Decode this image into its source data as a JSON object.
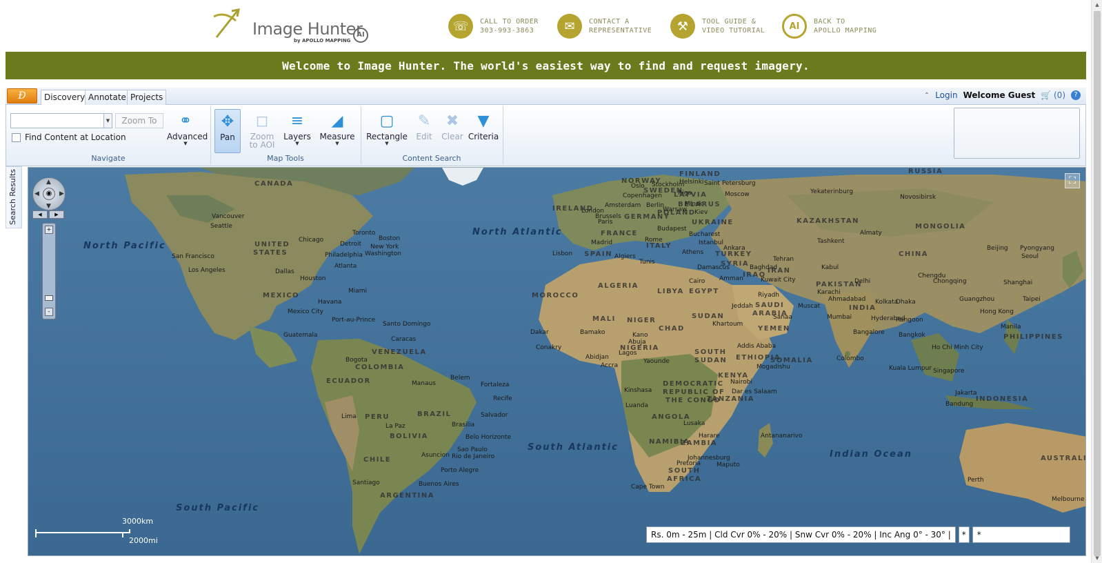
{
  "header": {
    "logo_text": "Image Hunter",
    "logo_sub": "by APOLLO MAPPING",
    "logo_badge": "AI",
    "links": [
      {
        "line1": "CALL TO ORDER",
        "line2": "303-993-3863",
        "icon": "phone-icon"
      },
      {
        "line1": "CONTACT A",
        "line2": "REPRESENTATIVE",
        "icon": "envelope-icon"
      },
      {
        "line1": "TOOL GUIDE &",
        "line2": "VIDEO TUTORIAL",
        "icon": "tools-icon"
      },
      {
        "line1": "BACK TO",
        "line2": "APOLLO MAPPING",
        "icon": "apollo-logo-icon"
      }
    ],
    "accent_color": "#b5a530"
  },
  "banner": {
    "text": "Welcome to Image Hunter. The world's easiest way to find and request imagery.",
    "color": "#6b7a1c"
  },
  "tabbar": {
    "app_button": "Ð",
    "tabs": [
      {
        "label": "Discovery",
        "active": true
      },
      {
        "label": "Annotate",
        "active": false
      },
      {
        "label": "Projects",
        "active": false
      }
    ],
    "login": "Login",
    "welcome": "Welcome Guest",
    "cart": "(0)"
  },
  "ribbon": {
    "navigate": {
      "group_label": "Navigate",
      "combo_value": "",
      "zoom_to": "Zoom To",
      "find_content": "Find Content at Location",
      "find_content_checked": false,
      "advanced": "Advanced"
    },
    "map_tools": {
      "group_label": "Map Tools",
      "pan": "Pan",
      "zoom_aoi_1": "Zoom",
      "zoom_aoi_2": "to AOI",
      "layers": "Layers",
      "measure": "Measure"
    },
    "content_search": {
      "group_label": "Content Search",
      "rectangle": "Rectangle",
      "edit": "Edit",
      "clear": "Clear",
      "criteria": "Criteria"
    }
  },
  "side": {
    "search_results": "Search Results"
  },
  "map": {
    "oceans": {
      "north_pacific": "North Pacific",
      "north_atlantic": "North Atlantic",
      "south_atlantic": "South Atlantic",
      "south_pacific": "South Pacific",
      "indian_ocean": "Indian Ocean"
    },
    "countries": {
      "canada": "CANADA",
      "russia": "RUSSIA",
      "united": "UNITED",
      "states": "STATES",
      "mexico": "MEXICO",
      "kazakhstan": "KAZAKHSTAN",
      "mongolia": "MONGOLIA",
      "china": "CHINA",
      "algeria": "ALGERIA",
      "libya": "LIBYA",
      "egypt": "EGYPT",
      "mali": "MALI",
      "niger": "NIGER",
      "chad": "CHAD",
      "sudan": "SUDAN",
      "saudi": "SAUDI",
      "arabia": "ARABIA",
      "iran": "IRAN",
      "pakistan": "PAKISTAN",
      "india": "INDIA",
      "brazil": "BRAZIL",
      "peru": "PERU",
      "bolivia": "BOLIVIA",
      "argentina": "ARGENTINA",
      "chile": "CHILE",
      "colombia": "COLOMBIA",
      "venezuela": "VENEZUELA",
      "ecuador": "ECUADOR",
      "angola": "ANGOLA",
      "zambia": "ZAMBIA",
      "namibia": "NAMIBIA",
      "south_africa_1": "SOUTH",
      "south_africa_2": "AFRICA",
      "ethiopia": "ETHIOPIA",
      "somalia": "SOMALIA",
      "kenya": "KENYA",
      "tanzania": "TANZANIA",
      "drc_1": "DEMOCRATIC",
      "drc_2": "REPUBLIC OF",
      "drc_3": "THE CONGO",
      "nigeria": "NIGERIA",
      "indonesia": "INDONESIA",
      "philippines": "PHILIPPINES",
      "australia": "AUSTRALIA",
      "morocco": "MOROCCO",
      "spain": "SPAIN",
      "france": "FRANCE",
      "germany": "GERMANY",
      "poland": "POLAND",
      "ukraine": "UKRAINE",
      "turkey": "TURKEY",
      "iraq": "IRAQ",
      "yemen": "YEMEN",
      "south_sudan_1": "SOUTH",
      "south_sudan_2": "SUDAN",
      "finland": "FINLAND",
      "norway": "NORWAY",
      "sweden": "SWEDEN",
      "italy": "ITALY",
      "latvia": "LATVIA",
      "belarus": "BELARUS",
      "ireland": "IRELAND",
      "syria": "SYRIA"
    },
    "cities": {
      "seattle": "Seattle",
      "vancouver": "Vancouver",
      "san_francisco": "San Francisco",
      "los_angeles": "Los Angeles",
      "chicago": "Chicago",
      "detroit": "Detroit",
      "toronto": "Toronto",
      "boston": "Boston",
      "new_york": "New York",
      "washington": "Washington",
      "philadelphia": "Philadelphia",
      "atlanta": "Atlanta",
      "dallas": "Dallas",
      "houston": "Houston",
      "miami": "Miami",
      "havana": "Havana",
      "mexico_city": "Mexico City",
      "guatemala": "Guatemala",
      "port_au_prince": "Port-au-Prince",
      "santo_domingo": "Santo Domingo",
      "caracas": "Caracas",
      "bogota": "Bogota",
      "lima": "Lima",
      "la_paz": "La Paz",
      "manaus": "Manaus",
      "belem": "Belem",
      "fortaleza": "Fortaleza",
      "recife": "Recife",
      "salvador": "Salvador",
      "brasilia": "Brasilia",
      "belo_horizonte": "Belo Horizonte",
      "sao_paulo": "Sao Paulo",
      "rio": "Rio de Janeiro",
      "asuncion": "Asuncion",
      "porto_alegre": "Porto Alegre",
      "buenos_aires": "Buenos Aires",
      "santiago": "Santiago",
      "lisbon": "Lisbon",
      "madrid": "Madrid",
      "london": "London",
      "paris": "Paris",
      "brussels": "Brussels",
      "amsterdam": "Amsterdam",
      "berlin": "Berlin",
      "rome": "Rome",
      "algiers": "Algiers",
      "tunis": "Tunis",
      "cairo": "Cairo",
      "athens": "Athens",
      "istanbul": "Istanbul",
      "ankara": "Ankara",
      "bucharest": "Bucharest",
      "budapest": "Budapest",
      "kiev": "Kiev",
      "moscow": "Moscow",
      "st_petersburg": "Saint Petersburg",
      "stockholm": "Stockholm",
      "helsinki": "Helsinki",
      "oslo": "Oslo",
      "copenhagen": "Copenhagen",
      "warsaw": "Warsaw",
      "minsk": "Minsk",
      "riga": "Riga",
      "baghdad": "Baghdad",
      "tehran": "Tehran",
      "riyadh": "Riyadh",
      "jeddah": "Jeddah",
      "kuwait": "Kuwait City",
      "damascus": "Damascus",
      "amman": "Amman",
      "karachi": "Karachi",
      "delhi": "Delhi",
      "mumbai": "Mumbai",
      "bangalore": "Bangalore",
      "hyderabad": "Hyderabad",
      "kolkata": "Kolkata",
      "ahmadabad": "Ahmadabad",
      "colombo": "Colombo",
      "dhaka": "Dhaka",
      "kabul": "Kabul",
      "tashkent": "Tashkent",
      "almaty": "Almaty",
      "beijing": "Beijing",
      "shanghai": "Shanghai",
      "seoul": "Seoul",
      "pyongyang": "Pyongyang",
      "chongqing": "Chongqing",
      "chengdu": "Chengdu",
      "guangzhou": "Guangzhou",
      "hong_kong": "Hong Kong",
      "taipei": "Taipei",
      "manila": "Manila",
      "bangkok": "Bangkok",
      "rangoon": "Rangoon",
      "ho_chi_minh": "Ho Chi Minh City",
      "kuala_lumpur": "Kuala Lumpur",
      "singapore": "Singapore",
      "jakarta": "Jakarta",
      "bandung": "Bandung",
      "perth": "Perth",
      "melbourne": "Melbourne",
      "novosibirsk": "Novosibirsk",
      "yekaterinburg": "Yekaterinburg",
      "dakar": "Dakar",
      "conakry": "Conakry",
      "abidjan": "Abidjan",
      "accra": "Accra",
      "lagos": "Lagos",
      "abuja": "Abuja",
      "kano": "Kano",
      "bamako": "Bamako",
      "khartoum": "Khartoum",
      "addis_ababa": "Addis Ababa",
      "mogadishu": "Mogadishu",
      "nairobi": "Nairobi",
      "dar_es_salaam": "Dar es Salaam",
      "kinshasa": "Kinshasa",
      "luanda": "Luanda",
      "lusaka": "Lusaka",
      "harare": "Harare",
      "johannesburg": "Johannesburg",
      "pretoria": "Pretoria",
      "maputo": "Maputo",
      "cape_town": "Cape Town",
      "antananarivo": "Antananarivo",
      "yaounde": "Yaounde",
      "sanaa": "Sanaa",
      "muscat": "Muscat"
    },
    "scale_km": "3000km",
    "scale_mi": "2000mi",
    "filter_summary": "Rs. 0m - 25m | Cld Cvr 0% - 20% | Snw Cvr 0% - 20% | Inc Ang 0° - 30° |",
    "filter_star1": "*",
    "filter_star2": "*"
  }
}
